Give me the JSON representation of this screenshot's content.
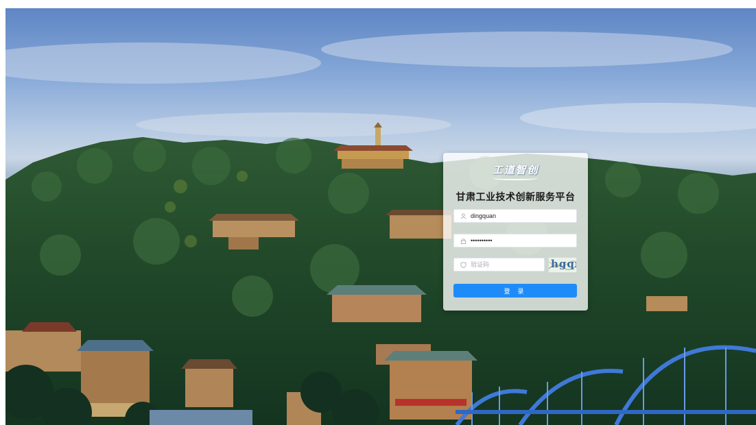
{
  "login": {
    "logo_text": "工道智创",
    "title": "甘肃工业技术创新服务平台",
    "username": {
      "value": "dingquan",
      "icon": "user-icon"
    },
    "password": {
      "value": "••••••••••",
      "icon": "lock-icon"
    },
    "captcha": {
      "placeholder": "验证码",
      "icon": "shield-icon",
      "image_text": "hgqn"
    },
    "submit_label": "登 录",
    "accent_color": "#1e8cf8"
  }
}
